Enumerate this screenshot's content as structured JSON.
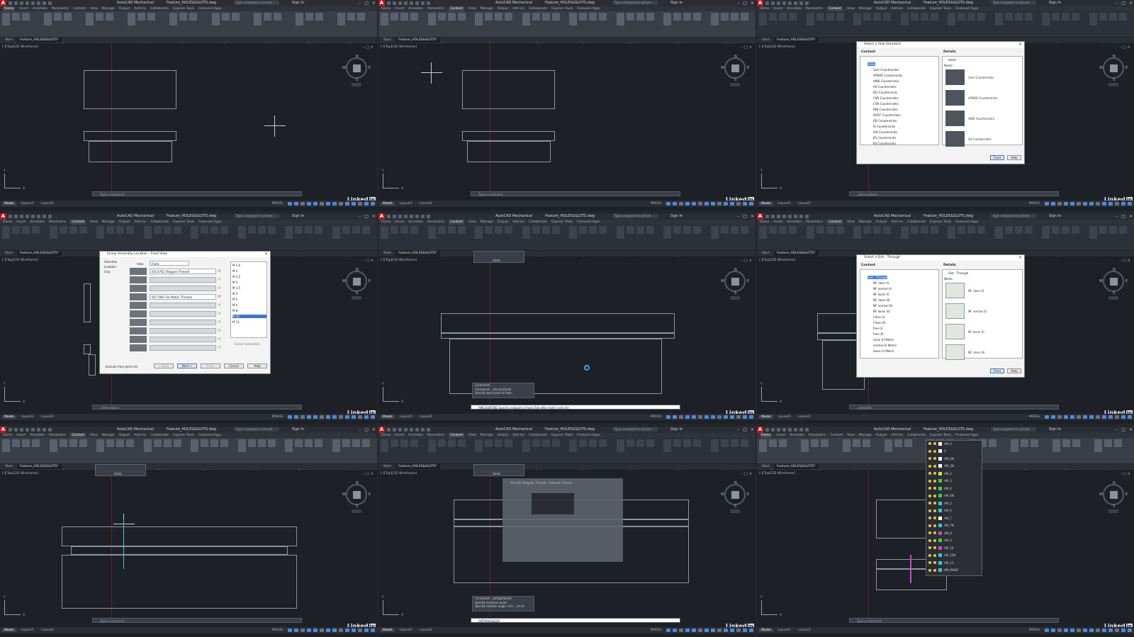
{
  "app": {
    "name": "AutoCAD Mechanical",
    "file": "Feature_HOLES&SLOTS.dwg",
    "search_placeholder": "Type a keyword or phrase",
    "signin": "Sign In"
  },
  "ribbon_tabs": [
    "Home",
    "Insert",
    "Annotate",
    "Parametric",
    "Content",
    "View",
    "Manage",
    "Output",
    "Add-ins",
    "Collaborate",
    "Express Tools",
    "Featured Apps"
  ],
  "file_tabs": [
    "Start",
    "Feature_HOLES&SLOTS*"
  ],
  "viewport_label": "[-][Top][2D Wireframe]",
  "layout_tabs": [
    "Model",
    "Layout1",
    "Layout2"
  ],
  "status_model": "MODEL",
  "command_placeholder": "Type a command",
  "brand": {
    "name": "Linked",
    "in": "in",
    "sub": "LEARNING"
  },
  "viewcube": {
    "n": "N",
    "s": "S",
    "e": "E",
    "w": "W",
    "center": "TOP",
    "wcs": "WCS"
  },
  "ucs": {
    "x": "X",
    "y": "Y"
  },
  "ribbon_groups_home": [
    "Draw",
    "Modify",
    "Layers",
    "Annotation",
    "Block",
    "Groups",
    "Utilities",
    "Clipboard",
    "View"
  ],
  "ribbon_groups_content": [
    "Library",
    "Fasteners",
    "Holes",
    "Shaft",
    "Parts",
    "Motion",
    "Tools",
    "Calculation"
  ],
  "panes": [
    {
      "cmd": "Type a command"
    },
    {
      "cmd": "Type a command"
    },
    {
      "cmd": "_amcounthole"
    },
    {
      "cmd": "_amscrewcon"
    },
    {
      "cmd": "AMCOUNTSID Specify endpoint of hole [Set after hole] <ent of>"
    },
    {
      "cmd": "_amslotthr"
    },
    {
      "cmd": "Type a command"
    },
    {
      "cmd": "AMTAPHOLE2D"
    },
    {
      "cmd": "Type a command"
    }
  ],
  "dialog_hole_standard": {
    "title": "Select a Hole Standard",
    "content_h": "Content",
    "details_h": "Details",
    "root": "Holes",
    "path": "Holes",
    "name_col": "Name",
    "items": [
      "User Countersinks",
      "AFNOR Countersinks",
      "ANSI Countersinks",
      "AS Countersinks",
      "BCI Countersinks",
      "CNS Countersinks",
      "CSN Countersinks",
      "DIN Countersinks",
      "DOST Countersinks",
      "GB Countersinks",
      "IS Countersinks",
      "ISO Countersinks",
      "JIS Countersinks",
      "KS Countersinks"
    ],
    "thumbs": [
      "User Countersinks",
      "AFNOR Countersinks",
      "ANSI Countersinks",
      "AS Countersinks"
    ],
    "close": "Close",
    "help": "Help"
  },
  "dialog_screw": {
    "title": "Screw Assembly Location - Front View",
    "nav": [
      "Selection",
      "Location",
      "Grip"
    ],
    "view_label": "View",
    "view_value": "Front",
    "rows": [
      "ISO 4762 (Regular Thread)",
      "",
      "",
      "ISO 7091 For Metric Threads",
      "",
      "",
      "",
      "",
      "",
      ""
    ],
    "sizes": [
      "M 1.6",
      "M 2",
      "M 2.5",
      "M 3",
      "M 3.5",
      "M 4",
      "M 5",
      "M 6",
      "M 8",
      "M 10",
      "M 12"
    ],
    "exclude": "Exclude from parts list",
    "screw_calc": "Screw Calculation",
    "buttons": [
      "< Back",
      "Next >",
      "Finish",
      "Cancel",
      "Help"
    ]
  },
  "dialog_slot": {
    "title": "Select a Slot - Through",
    "content_h": "Content",
    "details_h": "Details",
    "root": "Slot - Through",
    "path": "Slot - Through",
    "name_col": "Name",
    "items": [
      "NF close (I)",
      "NF normal (I)",
      "NF loose (I)",
      "NF close (II)",
      "NF normal (II)",
      "NF loose (II)",
      "Close (I)",
      "Close (II)",
      "free (I)",
      "free (II)",
      "close (I) Metric",
      "normal (I) Metric",
      "loose (I) Metric"
    ],
    "thumbs": [
      "NF close (I)",
      "NF normal (I)",
      "NF loose (I)",
      "NF close (II)"
    ],
    "close": "Close",
    "help": "Help"
  },
  "cmd_history_5": [
    "Command:",
    "Command: _amcounthole",
    "Specify start point of hole:"
  ],
  "cmd_history_8": [
    "Command: _amtaphole2d",
    "Specify insertion point:",
    "Specify rotation angle <0>: _int of"
  ],
  "popup_8_title": "ISO 262 (Regular Thread) - External Thread",
  "holes_panel_label": "Holes",
  "layers": [
    {
      "name": "AM_0",
      "color": "#ffffff"
    },
    {
      "name": "0",
      "color": "#ffffff"
    },
    {
      "name": "AM_0N",
      "color": "#ffffff"
    },
    {
      "name": "AM_3N",
      "color": "#ffffff"
    },
    {
      "name": "AM_2",
      "color": "#e0d34a"
    },
    {
      "name": "AM_3",
      "color": "#52c24a"
    },
    {
      "name": "AM_4",
      "color": "#52c24a"
    },
    {
      "name": "AM_4N",
      "color": "#52c24a"
    },
    {
      "name": "AM_5",
      "color": "#36c6d4"
    },
    {
      "name": "AM_6",
      "color": "#36c6d4"
    },
    {
      "name": "AM_7",
      "color": "#ffffff"
    },
    {
      "name": "AM_7N",
      "color": "#36c6d4"
    },
    {
      "name": "AM_8",
      "color": "#c84ac8"
    },
    {
      "name": "AM_9",
      "color": "#52c24a"
    },
    {
      "name": "AM_10",
      "color": "#c84ac8"
    },
    {
      "name": "AM_12N",
      "color": "#36c6d4"
    },
    {
      "name": "AM_11",
      "color": "#36c6d4"
    },
    {
      "name": "AM_PAREF",
      "color": "#36c6d4"
    }
  ]
}
